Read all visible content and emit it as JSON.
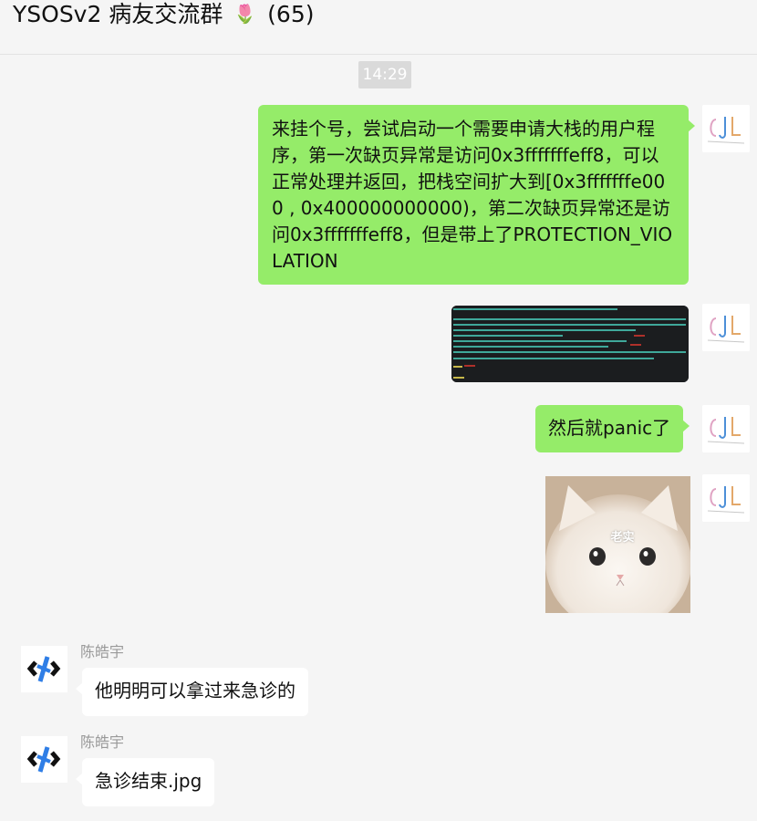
{
  "header": {
    "group_name": "YSOSv2 病友交流群",
    "flower_icon": "🌷",
    "member_count": "(65)"
  },
  "timestamp": "14:29",
  "messages": [
    {
      "sender": "me",
      "type": "text",
      "text": "来挂个号，尝试启动一个需要申请大栈的用户程序，第一次缺页异常是访问0x3fffffffeff8，可以正常处理并返回，把栈空间扩大到[0x3fffffffe000 , 0x400000000000)，第二次缺页异常还是访问0x3fffffffeff8，但是带上了PROTECTION_VIOLATION"
    },
    {
      "sender": "me",
      "type": "image",
      "description_icon": "terminal-screenshot"
    },
    {
      "sender": "me",
      "type": "text",
      "text": "然后就panic了"
    },
    {
      "sender": "me",
      "type": "image",
      "caption": "老实"
    },
    {
      "sender": "陈皓宇",
      "type": "text",
      "text": "他明明可以拿过来急诊的"
    },
    {
      "sender": "陈皓宇",
      "type": "text",
      "text": "急诊结束.jpg"
    }
  ],
  "colors": {
    "outgoing_bubble": "#95ec69",
    "incoming_bubble": "#ffffff",
    "background": "#f5f5f5",
    "sender_name": "#9a9a9a",
    "timestamp_bg": "#dadada"
  }
}
